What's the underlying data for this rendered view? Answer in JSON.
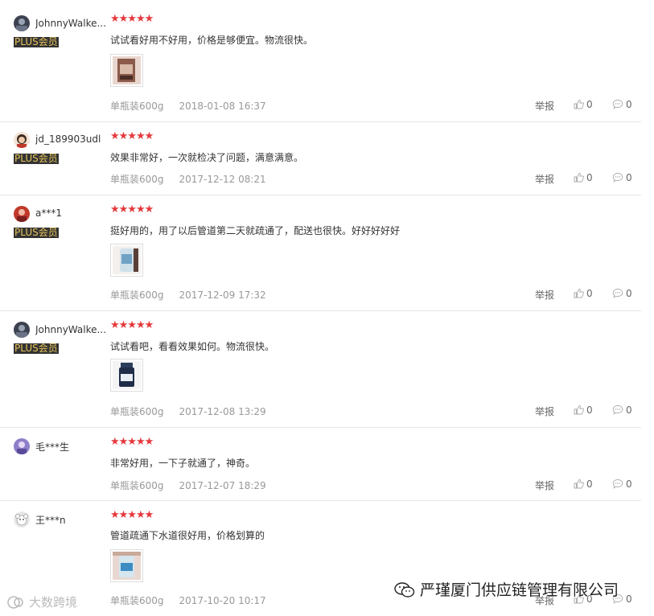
{
  "reviews": [
    {
      "user": "JohnnyWalke...",
      "badge": "PLUS会员",
      "stars": "★★★★★",
      "text": "试试看好用不好用，价格是够便宜。物流很快。",
      "has_image": true,
      "variant": "单瓶装600g",
      "date": "2018-01-08 16:37",
      "report": "举报",
      "likes": "0",
      "comments": "0"
    },
    {
      "user": "jd_189903udl",
      "badge": "PLUS会员",
      "stars": "★★★★★",
      "text": "效果非常好，一次就检决了问题，满意满意。",
      "has_image": false,
      "variant": "单瓶装600g",
      "date": "2017-12-12 08:21",
      "report": "举报",
      "likes": "0",
      "comments": "0"
    },
    {
      "user": "a***1",
      "badge": "PLUS会员",
      "stars": "★★★★★",
      "text": "挺好用的，用了以后管道第二天就疏通了，配送也很快。好好好好好",
      "has_image": true,
      "variant": "单瓶装600g",
      "date": "2017-12-09 17:32",
      "report": "举报",
      "likes": "0",
      "comments": "0"
    },
    {
      "user": "JohnnyWalke...",
      "badge": "PLUS会员",
      "stars": "★★★★★",
      "text": "试试看吧，看看效果如何。物流很快。",
      "has_image": true,
      "variant": "单瓶装600g",
      "date": "2017-12-08 13:29",
      "report": "举报",
      "likes": "0",
      "comments": "0"
    },
    {
      "user": "毛***生",
      "badge": "",
      "stars": "★★★★★",
      "text": "非常好用，一下子就通了，神奇。",
      "has_image": false,
      "variant": "单瓶装600g",
      "date": "2017-12-07 18:29",
      "report": "举报",
      "likes": "0",
      "comments": "0"
    },
    {
      "user": "王***n",
      "badge": "",
      "stars": "★★★★★",
      "text": "管道疏通下水道很好用，价格划算的",
      "has_image": true,
      "variant": "单瓶装600g",
      "date": "2017-10-20 10:17",
      "report": "举报",
      "likes": "0",
      "comments": "0"
    }
  ],
  "watermarks": {
    "right": "严瑾厦门供应链管理有限公司",
    "left": "大数跨境"
  },
  "colors": {
    "star": "#e4393c",
    "plus_bg": "#333333",
    "plus_text": "#e6c35c",
    "divider": "#e6e6e6"
  }
}
